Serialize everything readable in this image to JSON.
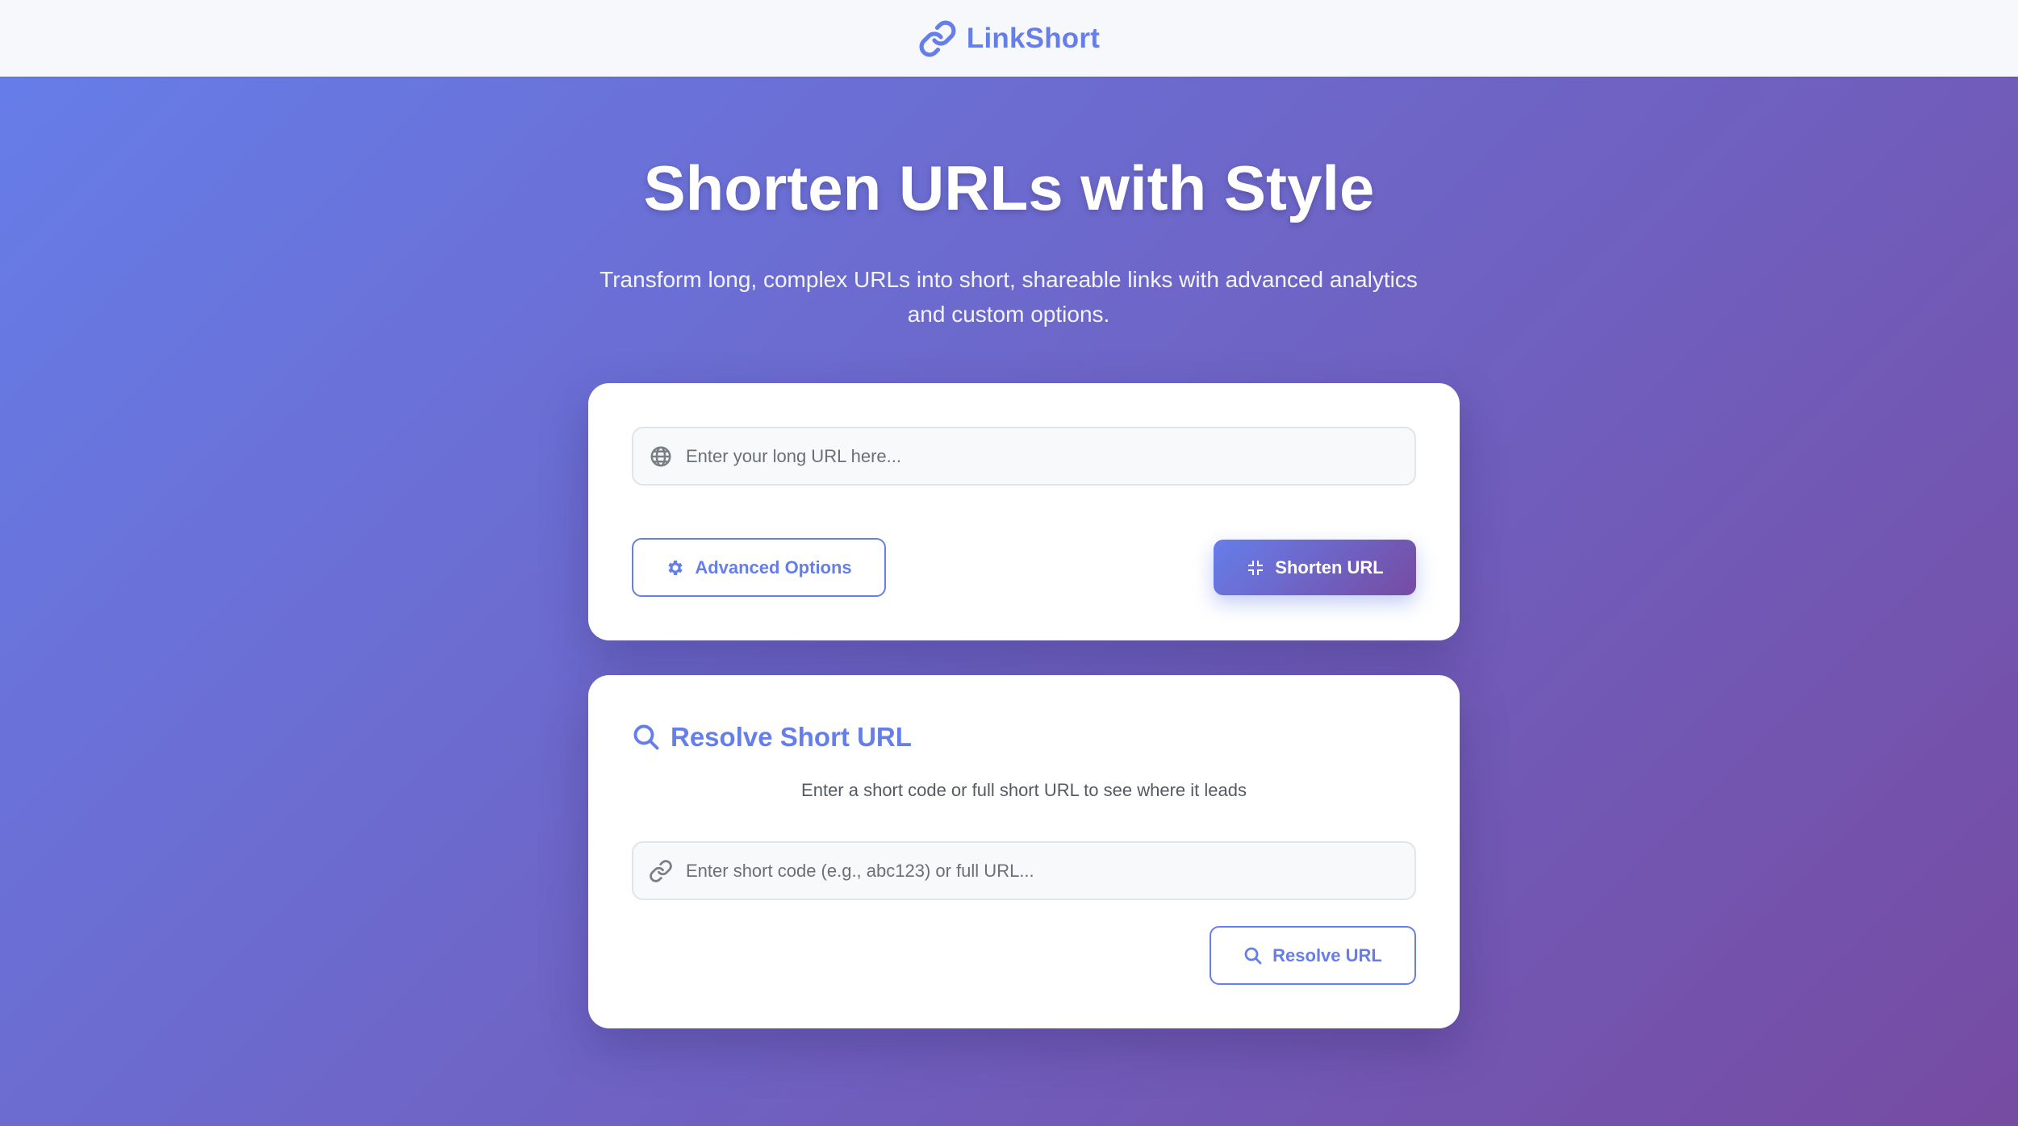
{
  "header": {
    "brand": "LinkShort",
    "brand_icon": "link-icon"
  },
  "hero": {
    "title": "Shorten URLs with Style",
    "subtitle": "Transform long, complex URLs into short, shareable links with advanced analytics and custom options."
  },
  "shorten_form": {
    "url_input": {
      "value": "",
      "placeholder": "Enter your long URL here...",
      "icon": "globe-icon"
    },
    "advanced_button": {
      "label": "Advanced Options",
      "icon": "gear-icon"
    },
    "shorten_button": {
      "label": "Shorten URL",
      "icon": "compress-icon"
    }
  },
  "resolve_form": {
    "title": "Resolve Short URL",
    "title_icon": "search-icon",
    "description": "Enter a short code or full short URL to see where it leads",
    "code_input": {
      "value": "",
      "placeholder": "Enter short code (e.g., abc123) or full URL...",
      "icon": "link-icon"
    },
    "resolve_button": {
      "label": "Resolve URL",
      "icon": "search-icon"
    }
  },
  "colors": {
    "accent": "#667eea",
    "gradient_start": "#667eea",
    "gradient_end": "#764ba2",
    "header_bg": "#f7f8fb"
  }
}
